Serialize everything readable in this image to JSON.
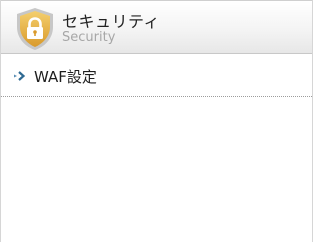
{
  "section": {
    "title": "セキュリティ",
    "subtitle": "Security",
    "icon": "shield-lock-icon",
    "icon_color": "#e9b84e"
  },
  "nav": {
    "items": [
      {
        "label": "WAF設定",
        "icon": "double-arrow-icon"
      }
    ]
  }
}
